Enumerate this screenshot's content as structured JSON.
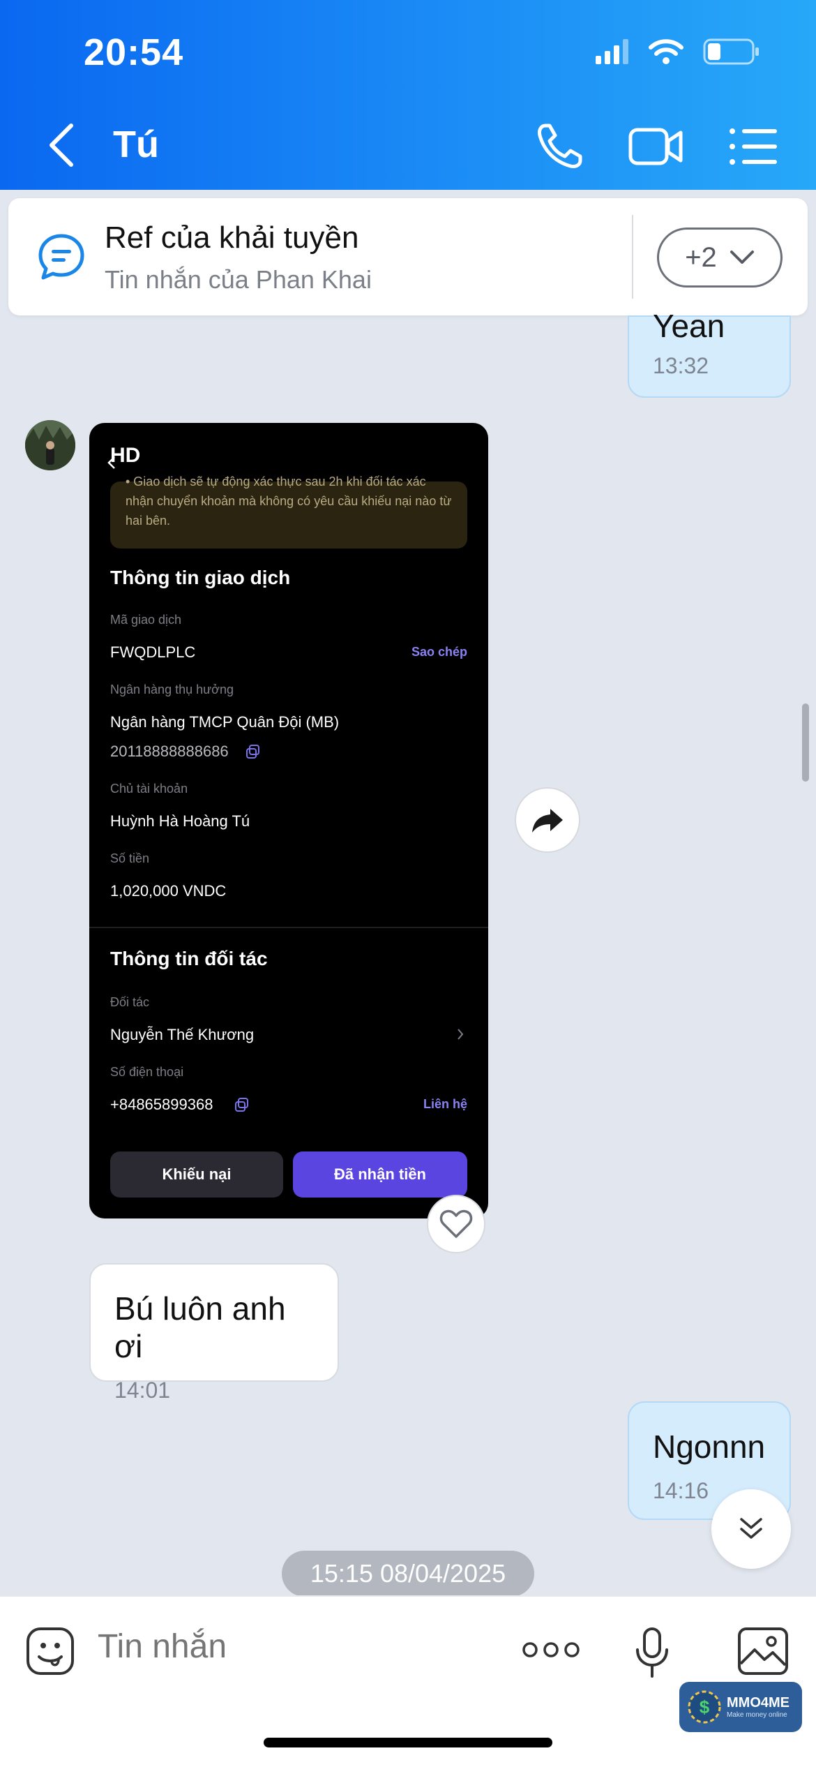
{
  "status_bar": {
    "time": "20:54"
  },
  "header": {
    "title": "Tú"
  },
  "pinned": {
    "title": "Ref của khải tuyền",
    "subtitle": "Tin nhắn của Phan Khai",
    "more_count": "+2"
  },
  "messages": [
    {
      "direction": "out",
      "text": "Yean",
      "time": "13:32"
    },
    {
      "direction": "in",
      "text": "Bú luôn anh ơi",
      "time": "14:01"
    },
    {
      "direction": "out",
      "text": "Ngonnn",
      "time": "14:16"
    }
  ],
  "screenshot": {
    "header": "HD",
    "note": "• Giao dịch sẽ tự động xác thực sau 2h khi đối tác xác nhận chuyển khoản mà không có yêu cầu khiếu nại nào từ hai bên.",
    "section_transaction": "Thông tin giao dịch",
    "label_code": "Mã giao dịch",
    "code": "FWQDLPLC",
    "copy_label": "Sao chép",
    "label_bank": "Ngân hàng thụ hưởng",
    "bank": "Ngân hàng TMCP Quân Đội (MB)",
    "account_number": "20118888888686",
    "label_owner": "Chủ tài khoản",
    "owner": "Huỳnh Hà Hoàng Tú",
    "label_amount": "Số tiền",
    "amount": "1,020,000 VNDC",
    "section_partner": "Thông tin đối tác",
    "label_partner": "Đối tác",
    "partner": "Nguyễn Thế Khương",
    "label_phone": "Số điện thoại",
    "phone": "+84865899368",
    "contact_label": "Liên hệ",
    "btn_complaint": "Khiếu nại",
    "btn_received": "Đã nhận tiền"
  },
  "date_separator": "15:15 08/04/2025",
  "input": {
    "placeholder": "Tin nhắn"
  },
  "watermark": {
    "name": "MMO4ME",
    "tagline": "Make money online"
  },
  "colors": {
    "header_start": "#0a68f0",
    "header_end": "#27a8f8",
    "accent_purple": "#5b45e0",
    "out_bubble": "#d5ecfd"
  }
}
